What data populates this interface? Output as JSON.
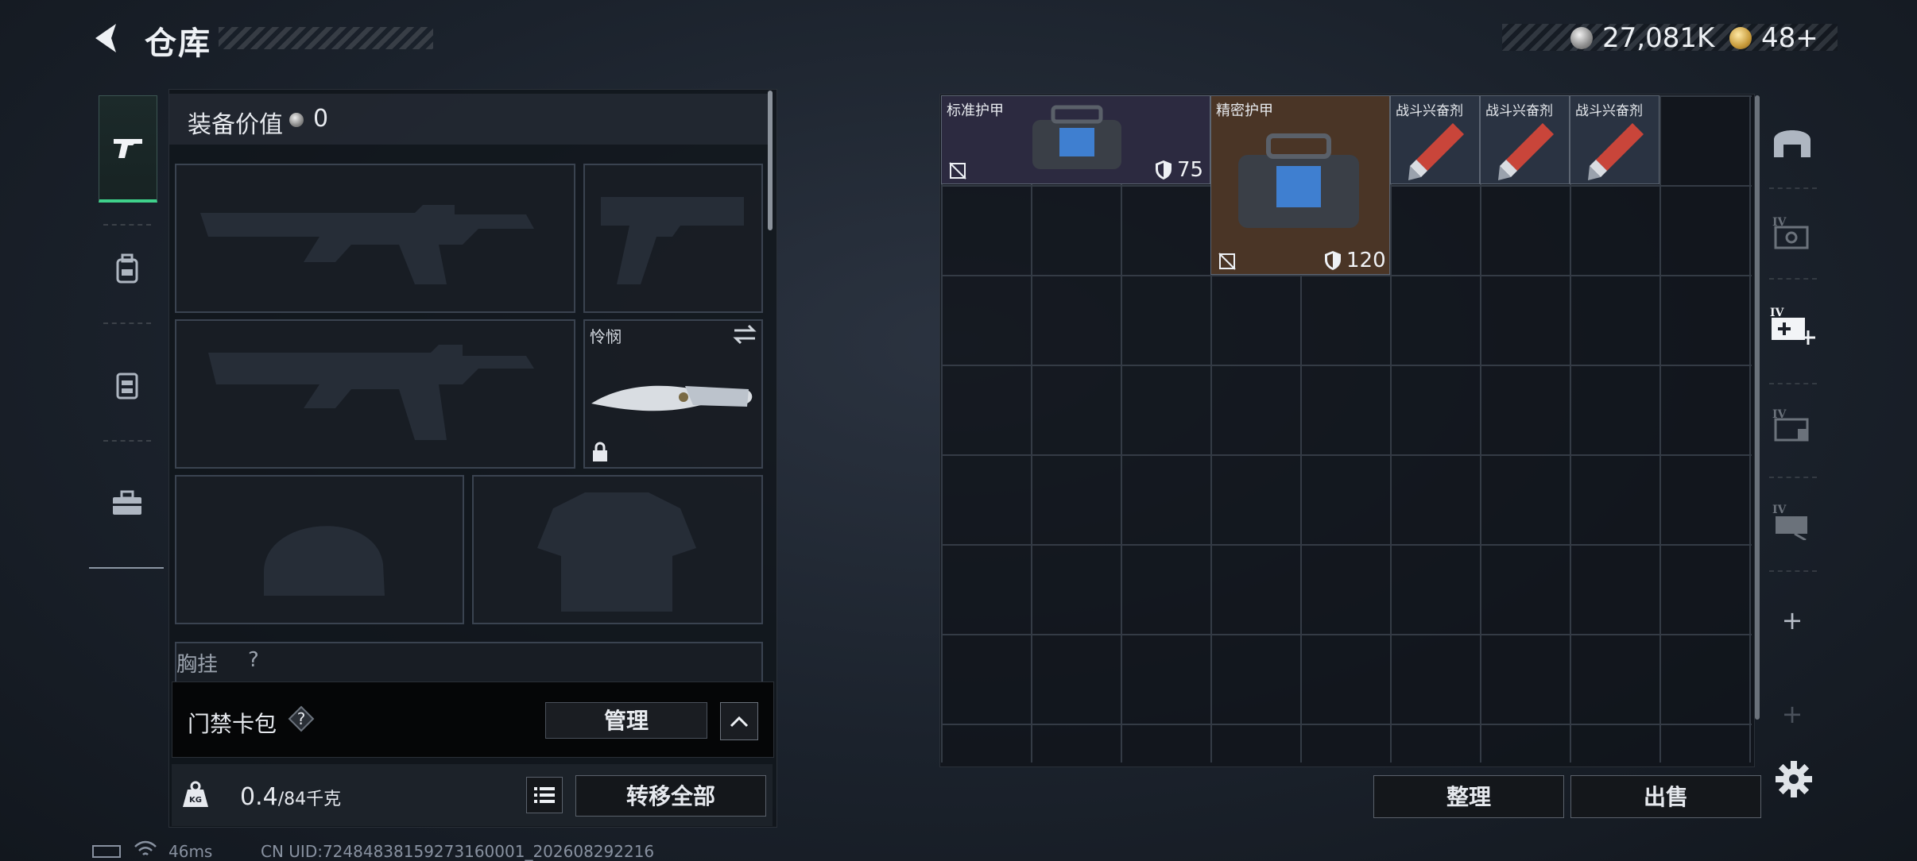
{
  "header": {
    "title": "仓库",
    "silver": "27,081K",
    "gold": "48+"
  },
  "left_tabs": [
    "pistol-icon",
    "backpack-icon",
    "chest-rig-icon",
    "toolbox-icon"
  ],
  "equipment": {
    "value_label": "装备价值",
    "value": "0",
    "melee_name": "怜悯",
    "chest_label": "胸挂",
    "chest_hint": "?"
  },
  "access_card": {
    "label": "门禁卡包",
    "help": "?",
    "manage": "管理"
  },
  "capacity": {
    "current": "0.4",
    "max_with_unit": "/84千克",
    "transfer_all": "转移全部"
  },
  "grid_items": [
    {
      "name": "标准护甲",
      "value": "75",
      "color": "#2c2a40"
    },
    {
      "name": "精密护甲",
      "value": "120",
      "color": "#4a3526"
    },
    {
      "name": "战斗兴奋剂",
      "color": "#2a3342"
    },
    {
      "name": "战斗兴奋剂",
      "color": "#2a3342"
    },
    {
      "name": "战斗兴奋剂",
      "color": "#2a3342"
    }
  ],
  "actions": {
    "sort": "整理",
    "sell": "出售"
  },
  "right_rail": [
    "helmet-slot-icon",
    "stash-iv-icon",
    "stash-iv-add-icon",
    "stash-iv-box-icon",
    "stash-iv-case-icon",
    "+",
    "+"
  ],
  "status": {
    "ping": "46ms",
    "uid": "CN UID:72484838159273160001_202608292216"
  }
}
